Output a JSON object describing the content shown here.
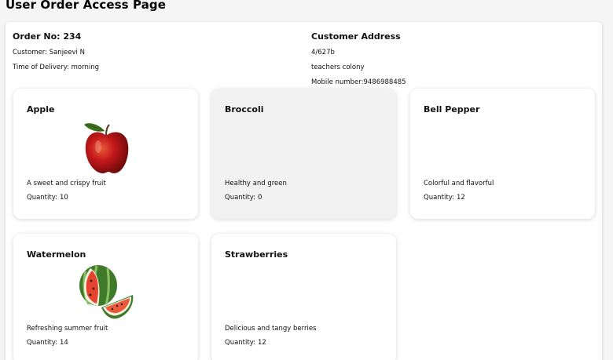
{
  "page": {
    "title": "User Order Access Page"
  },
  "order": {
    "number_label": "Order No: 234",
    "customer_label": "Customer: Sanjeevi N",
    "delivery_label": "Time of Delivery: morning"
  },
  "address": {
    "title": "Customer Address",
    "lines": [
      "4/627b",
      "teachers colony",
      "Mobile number:9486988485"
    ]
  },
  "products": [
    {
      "name": "Apple",
      "description": "A sweet and crispy fruit",
      "quantity_label": "Quantity:",
      "quantity": "10",
      "image": "apple-image"
    },
    {
      "name": "Broccoli",
      "description": "Healthy and green",
      "quantity_label": "Quantity:",
      "quantity": "0",
      "image": ""
    },
    {
      "name": "Bell Pepper",
      "description": "Colorful and flavorful",
      "quantity_label": "Quantity:",
      "quantity": "12",
      "image": ""
    },
    {
      "name": "Watermelon",
      "description": "Refreshing summer fruit",
      "quantity_label": "Quantity:",
      "quantity": "14",
      "image": "watermelon-image"
    },
    {
      "name": "Strawberries",
      "description": "Delicious and tangy berries",
      "quantity_label": "Quantity:",
      "quantity": "12",
      "image": ""
    }
  ],
  "colors": {
    "card_background": "#ffffff",
    "card_background_zero_qty": "#f2f2f2",
    "page_background": "#f5f5f5"
  }
}
